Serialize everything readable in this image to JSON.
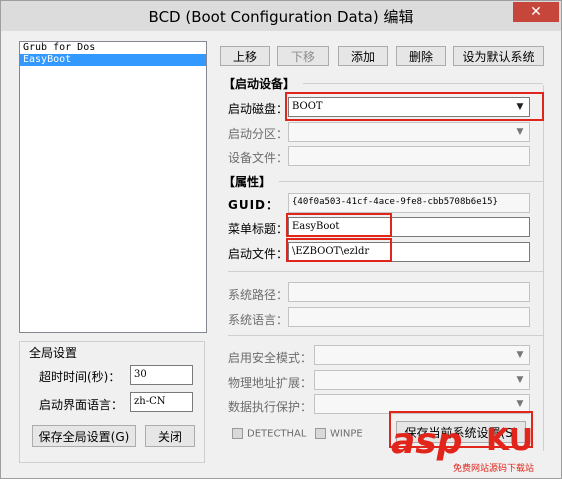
{
  "window": {
    "title": "BCD (Boot Configuration Data) 编辑",
    "close_symbol": "✕"
  },
  "entries": [
    "Grub for Dos",
    "EasyBoot"
  ],
  "toolbar": {
    "up": "上移",
    "down": "下移",
    "add": "添加",
    "delete": "删除",
    "set_default": "设为默认系统"
  },
  "boot_device": {
    "section": "【启动设备】",
    "disk_label": "启动磁盘：",
    "disk_value": "BOOT",
    "partition_label": "启动分区：",
    "device_file_label": "设备文件："
  },
  "properties": {
    "section": "【属性】",
    "guid_label": "GUID：",
    "guid_value": "{40f0a503-41cf-4ace-9fe8-cbb5708b6e15}",
    "menu_title_label": "菜单标题：",
    "menu_title_value": "EasyBoot",
    "boot_file_label": "启动文件：",
    "boot_file_value": "\\EZBOOT\\ezldr",
    "system_path_label": "系统路径：",
    "system_lang_label": "系统语言："
  },
  "options": {
    "safe_mode_label": "启用安全模式：",
    "pae_label": "物理地址扩展：",
    "dep_label": "数据执行保护：",
    "detecthal": "DETECTHAL",
    "winpe": "WINPE",
    "save_current": "保存当前系统设置(S)"
  },
  "global": {
    "section": "全局设置",
    "timeout_label": "超时时间(秒)：",
    "timeout_value": "30",
    "lang_label": "启动界面语言：",
    "lang_value": "zh-CN",
    "save_global": "保存全局设置(G)",
    "close": "关闭"
  },
  "watermark": {
    "asp": "asp",
    "ku": "KU",
    "sub": "免费网站源码下载站"
  },
  "colors": {
    "highlight": "#e1251b",
    "selection": "#3399ff"
  }
}
